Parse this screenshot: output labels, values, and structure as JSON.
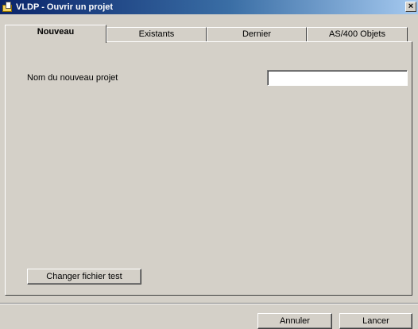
{
  "window": {
    "title": "VLDP - Ouvrir un  projet",
    "close_label": "×"
  },
  "tabs": [
    {
      "label": "Nouveau",
      "active": true
    },
    {
      "label": "Existants",
      "active": false
    },
    {
      "label": "Dernier",
      "active": false
    },
    {
      "label": "AS/400 Objets",
      "active": false
    }
  ],
  "form": {
    "project_name_label": "Nom du nouveau projet",
    "project_name_value": "",
    "change_file_button": "Changer fichier test"
  },
  "footer": {
    "cancel_button": "Annuler",
    "launch_button": "Lancer"
  },
  "icons": {
    "app": "folder-document-icon",
    "close": "close-icon"
  }
}
